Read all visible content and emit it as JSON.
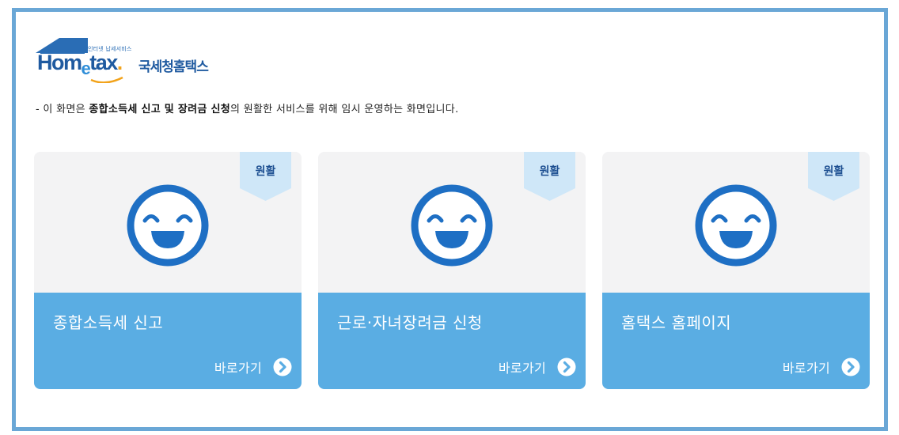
{
  "logo": {
    "tagline": "인터넷 납세서비스",
    "word_left": "Hom",
    "word_e": "e",
    "word_right": "tax",
    "korean_name": "국세청홈택스"
  },
  "notice": {
    "prefix": "- 이 화면은 ",
    "bold": "종합소득세 신고 및 장려금 신청",
    "suffix": "의 원활한 서비스를 위해 임시 운영하는 화면입니다."
  },
  "cards": [
    {
      "status": "원활",
      "title": "종합소득세 신고",
      "link_label": "바로가기"
    },
    {
      "status": "원활",
      "title": "근로·자녀장려금 신청",
      "link_label": "바로가기"
    },
    {
      "status": "원활",
      "title": "홈택스 홈페이지",
      "link_label": "바로가기"
    }
  ],
  "colors": {
    "frame": "#6aa7d6",
    "card_bottom": "#5aade3",
    "ribbon": "#cfe7f8",
    "face": "#1e6fc4",
    "brand": "#1f5aa0"
  }
}
